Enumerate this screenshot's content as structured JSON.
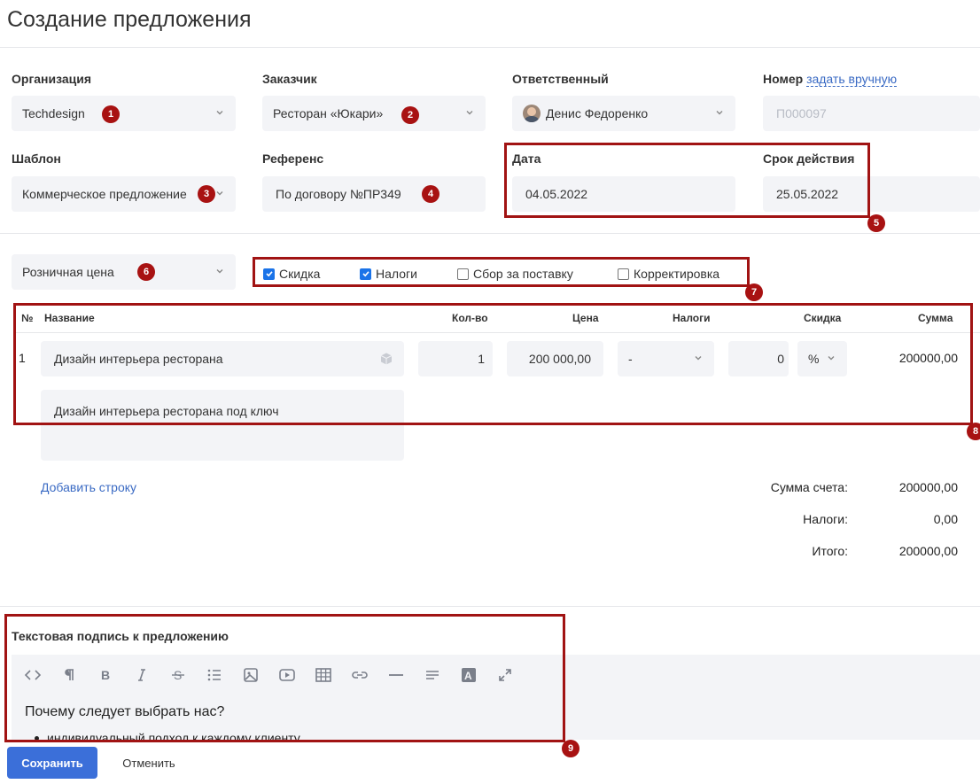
{
  "page": {
    "title": "Создание предложения"
  },
  "form": {
    "organization": {
      "label": "Организация",
      "value": "Techdesign"
    },
    "customer": {
      "label": "Заказчик",
      "value": "Ресторан «Юкари»"
    },
    "responsible": {
      "label": "Ответственный",
      "value": "Денис Федоренко"
    },
    "number": {
      "label": "Номер",
      "link": "задать вручную",
      "placeholder": "П000097"
    },
    "template": {
      "label": "Шаблон",
      "value": "Коммерческое предложение"
    },
    "reference": {
      "label": "Референс",
      "value": "По договору №ПР349"
    },
    "date": {
      "label": "Дата",
      "value": "04.05.2022"
    },
    "validity": {
      "label": "Срок действия",
      "value": "25.05.2022"
    },
    "price_type": {
      "value": "Розничная цена"
    }
  },
  "options": {
    "discount": {
      "label": "Скидка",
      "checked": true
    },
    "taxes": {
      "label": "Налоги",
      "checked": true
    },
    "delivery_fee": {
      "label": "Сбор за поставку",
      "checked": false
    },
    "adjustment": {
      "label": "Корректировка",
      "checked": false
    }
  },
  "table": {
    "headers": {
      "num": "№",
      "name": "Название",
      "qty": "Кол-во",
      "price": "Цена",
      "taxes": "Налоги",
      "discount": "Скидка",
      "sum": "Сумма"
    },
    "rows": [
      {
        "num": "1",
        "name": "Дизайн интерьера ресторана",
        "description": "Дизайн интерьера ресторана под ключ",
        "qty": "1",
        "price": "200 000,00",
        "taxes": "-",
        "discount": "0",
        "discount_unit": "%",
        "sum": "200000,00"
      }
    ],
    "add_row": "Добавить строку"
  },
  "totals": {
    "subtotal_label": "Сумма счета:",
    "subtotal": "200000,00",
    "taxes_label": "Налоги:",
    "taxes": "0,00",
    "total_label": "Итого:",
    "total": "200000,00"
  },
  "editor": {
    "label": "Текстовая подпись к предложению",
    "heading": "Почему следует выбрать нас?",
    "bullet": "индивидуальный подход к каждому клиенту",
    "toolbar": [
      "code-icon",
      "paragraph-icon",
      "bold-icon",
      "italic-icon",
      "strikethrough-icon",
      "list-icon",
      "image-icon",
      "video-icon",
      "table-icon",
      "link-icon",
      "horizontal-rule-icon",
      "align-icon",
      "text-color-icon",
      "fullscreen-icon"
    ]
  },
  "actions": {
    "save": "Сохранить",
    "cancel": "Отменить"
  },
  "annotations": [
    "1",
    "2",
    "3",
    "4",
    "5",
    "6",
    "7",
    "8",
    "9"
  ],
  "colors": {
    "accent": "#3b6fd9",
    "annotation": "#a81212",
    "link": "#3b6bc4",
    "checkbox": "#1a73e8"
  }
}
